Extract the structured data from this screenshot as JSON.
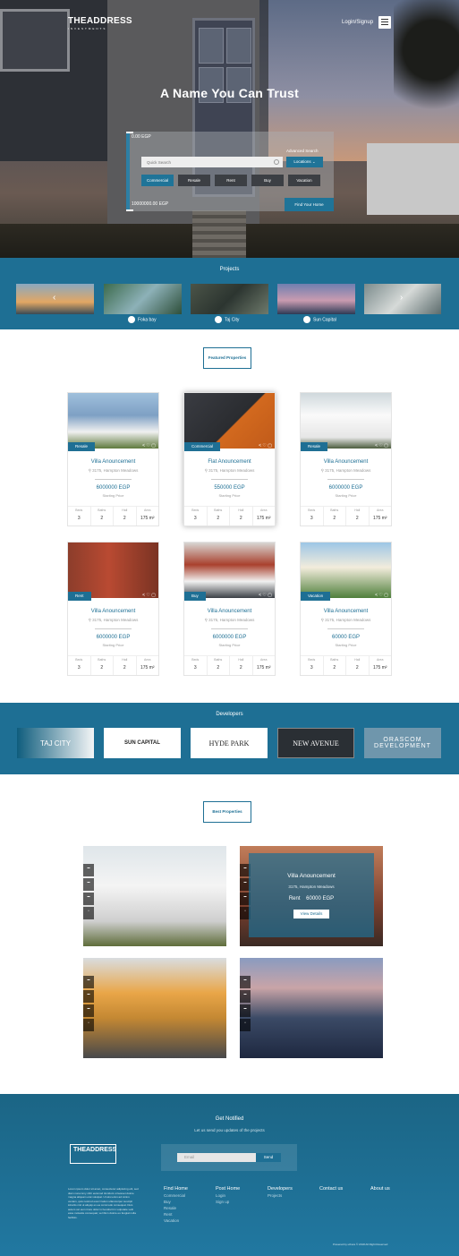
{
  "header": {
    "logo": "THEADDRESS",
    "logo_sub": "INVESTMENTS",
    "login": "Login/Signup",
    "hero_title": "A Name You Can Trust"
  },
  "search": {
    "min_price": "0.00 EGP",
    "max_price": "10000000.00 EGP",
    "advanced": "Advanced Search",
    "placeholder": "Quick Search",
    "locations": "Locations",
    "tabs": [
      "Commercial",
      "Resale",
      "Rent",
      "Buy",
      "Vacation"
    ],
    "find": "Find Your Home"
  },
  "projects": {
    "title": "Projects",
    "items": [
      "Foka bay",
      "Taj City",
      "Sun Capital"
    ]
  },
  "featured": {
    "title": "Featured Properties",
    "headers": [
      "Beds",
      "Baths",
      "Hall",
      "Area"
    ],
    "starting": "Starting Price",
    "cards": [
      {
        "tag": "Resale",
        "name": "Villa Anouncement",
        "addr": "3175, Hampton Meadows",
        "price": "6000000 EGP",
        "vals": [
          "3",
          "2",
          "2",
          "175 m²"
        ]
      },
      {
        "tag": "Commercial",
        "name": "Flat Anouncement",
        "addr": "3175, Hampton Meadows",
        "price": "550000 EGP",
        "vals": [
          "3",
          "2",
          "2",
          "175 m²"
        ]
      },
      {
        "tag": "Resale",
        "name": "Villa Anouncement",
        "addr": "3175, Hampton Meadows",
        "price": "6000000 EGP",
        "vals": [
          "3",
          "2",
          "2",
          "175 m²"
        ]
      },
      {
        "tag": "Rent",
        "name": "Villa Anouncement",
        "addr": "3175, Hampton Meadows",
        "price": "6000000 EGP",
        "vals": [
          "3",
          "2",
          "2",
          "175 m²"
        ]
      },
      {
        "tag": "Buy",
        "name": "Villa Anouncement",
        "addr": "3175, Hampton Meadows",
        "price": "6000000 EGP",
        "vals": [
          "3",
          "2",
          "2",
          "175 m²"
        ]
      },
      {
        "tag": "Vacation",
        "name": "Villa Anouncement",
        "addr": "3175, Hampton Meadows",
        "price": "60000 EGP",
        "vals": [
          "3",
          "2",
          "2",
          "175 m²"
        ]
      }
    ]
  },
  "developers": {
    "title": "Developers",
    "logos": [
      "TAJ CITY",
      "SUN CAPITAL",
      "HYDE PARK",
      "NEW AVENUE",
      "ORASCOM DEVELOPMENT"
    ]
  },
  "best": {
    "title": "Best Properties",
    "featured_name": "Villa Anouncement",
    "featured_addr": "3175, Hampton Meadows",
    "featured_price": "Rent    60000 EGP",
    "view": "View Details"
  },
  "footer": {
    "title": "Get Notified",
    "subtitle": "Let us send you updates of the projects",
    "email": "Email",
    "send": "Send",
    "about_text": "Lorem ipsum dolor sit amet, consectetur adipiscing elit, sed diam nonummy nibh euismod tincidunt ut laoreet dolore magna aliquam erat volutpat. Ut wisi enim ad minim veniam, quis nostrud exerci tation ullamcorper suscipit lobortis nisl ut aliquip ex ea commodo consequat. Duis autem vel eum iriure dolor in hendrerit in vulputate velit esse molestie consequat, vel illum dolore eu feugiat nulla facilisis.",
    "cols": [
      {
        "title": "Find Home",
        "links": [
          "Commercial",
          "Buy",
          "Resale",
          "Rent",
          "Vacation"
        ]
      },
      {
        "title": "Post Home",
        "links": [
          "Login",
          "Sign up"
        ]
      },
      {
        "title": "Developers",
        "links": [
          "Projects"
        ]
      },
      {
        "title": "Contact us",
        "links": []
      },
      {
        "title": "About us",
        "links": []
      }
    ],
    "copyright": "Powered by uthora © 2018 All Right Reserved"
  }
}
